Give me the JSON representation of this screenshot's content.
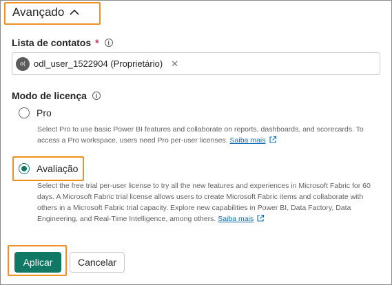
{
  "advanced": {
    "title": "Avançado"
  },
  "contacts": {
    "label": "Lista de contatos",
    "required_mark": "*",
    "info_glyph": "i",
    "chip": {
      "avatar_initials": "o(",
      "name": "odl_user_1522904 (Proprietário)",
      "remove_glyph": "✕"
    }
  },
  "license": {
    "label": "Modo de licença",
    "info_glyph": "i",
    "options": [
      {
        "label": "Pro",
        "checked": false,
        "description": "Select Pro to use basic Power BI features and collaborate on reports, dashboards, and scorecards. To access a Pro workspace, users need Pro per-user licenses.",
        "link": "Saiba mais"
      },
      {
        "label": "Avaliação",
        "checked": true,
        "description": "Select the free trial per-user license to try all the new features and experiences in Microsoft Fabric for 60 days. A Microsoft Fabric trial license allows users to create Microsoft Fabric items and collaborate with others in a Microsoft Fabric trial capacity. Explore new capabilities in Power BI, Data Factory, Data Engineering, and Real-Time Intelligence, among others.",
        "link": "Saiba mais"
      }
    ]
  },
  "actions": {
    "apply": "Aplicar",
    "cancel": "Cancelar"
  },
  "colors": {
    "accent": "#117865",
    "highlight": "#f0901e",
    "link": "#0f6cbd",
    "required": "#c4314b"
  }
}
